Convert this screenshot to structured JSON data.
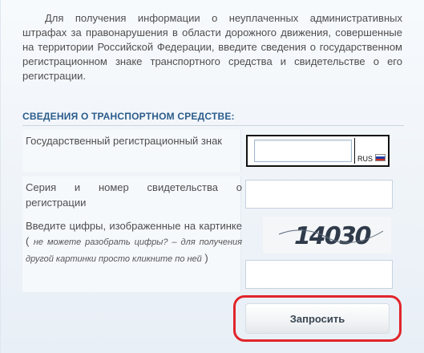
{
  "intro": {
    "text": "Для получения информации о неуплаченных административных штрафах за правонарушения в области дорожного движения, совершенные на территории Российской Федерации, введите сведения о государственном регистрационном знаке транспортного средства и свидетельстве о его регистрации."
  },
  "section": {
    "title": "СВЕДЕНИЯ О ТРАНСПОРТНОМ СРЕДСТВЕ:"
  },
  "fields": {
    "plate": {
      "label": "Государственный регистрационный знак",
      "value": "",
      "region_label": "RUS"
    },
    "certificate": {
      "label": "Серия и номер свидетельства о регистрации",
      "value": ""
    },
    "captcha": {
      "label": "Введите цифры, изображенные на картинке",
      "open_paren": "(",
      "hint": "не можете разобрать цифры? – для получения другой картинки просто кликните по ней",
      "close_paren": ")",
      "image_text": "14030",
      "value": ""
    }
  },
  "actions": {
    "submit_label": "Запросить"
  },
  "colors": {
    "section_title": "#2b5c8c",
    "highlight_border": "#e1252b",
    "flag_white": "#ffffff",
    "flag_blue": "#1f3fa6",
    "flag_red": "#d52b1e"
  }
}
